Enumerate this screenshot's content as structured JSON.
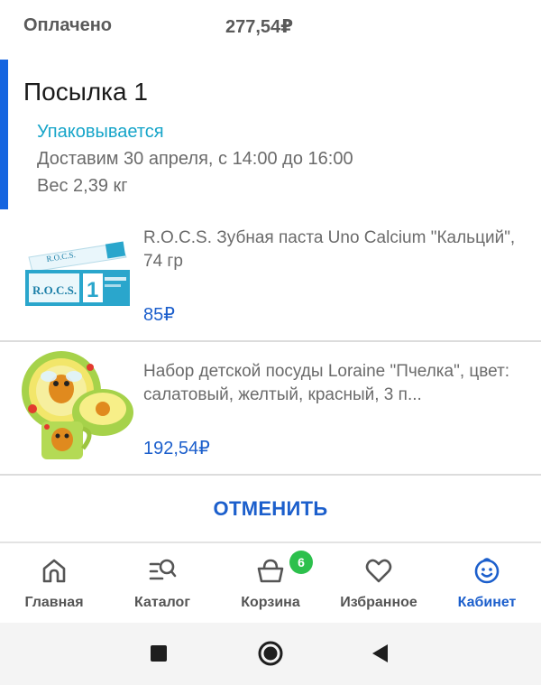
{
  "payment": {
    "label": "Оплачено",
    "amount": "277,54₽"
  },
  "parcel": {
    "title": "Посылка 1",
    "status": "Упаковывается",
    "delivery": "Доставим 30 апреля, с 14:00 до 16:00",
    "weight": "Вес 2,39 кг",
    "accent_color": "#1565e0",
    "status_color": "#17a5c9"
  },
  "products": [
    {
      "name": "R.O.C.S. Зубная паста Uno Calcium \"Кальций\", 74 гр",
      "price": "85₽",
      "image_text": "R.O.C.S."
    },
    {
      "name": "Набор детской посуды Loraine \"Пчелка\", цвет: салатовый, желтый, красный, 3 п...",
      "price": "192,54₽"
    }
  ],
  "cancel_button": {
    "label": "ОТМЕНИТЬ"
  },
  "bottom_nav": {
    "items": [
      {
        "label": "Главная",
        "icon": "home-icon"
      },
      {
        "label": "Каталог",
        "icon": "catalog-search-icon"
      },
      {
        "label": "Корзина",
        "icon": "basket-icon",
        "badge": "6"
      },
      {
        "label": "Избранное",
        "icon": "heart-icon"
      },
      {
        "label": "Кабинет",
        "icon": "profile-smile-icon",
        "active": true
      }
    ],
    "active_color": "#1c5fcc",
    "badge_color": "#2cc04c"
  },
  "system_nav": {
    "buttons": [
      "recents-square-icon",
      "home-circle-icon",
      "back-triangle-icon"
    ]
  }
}
